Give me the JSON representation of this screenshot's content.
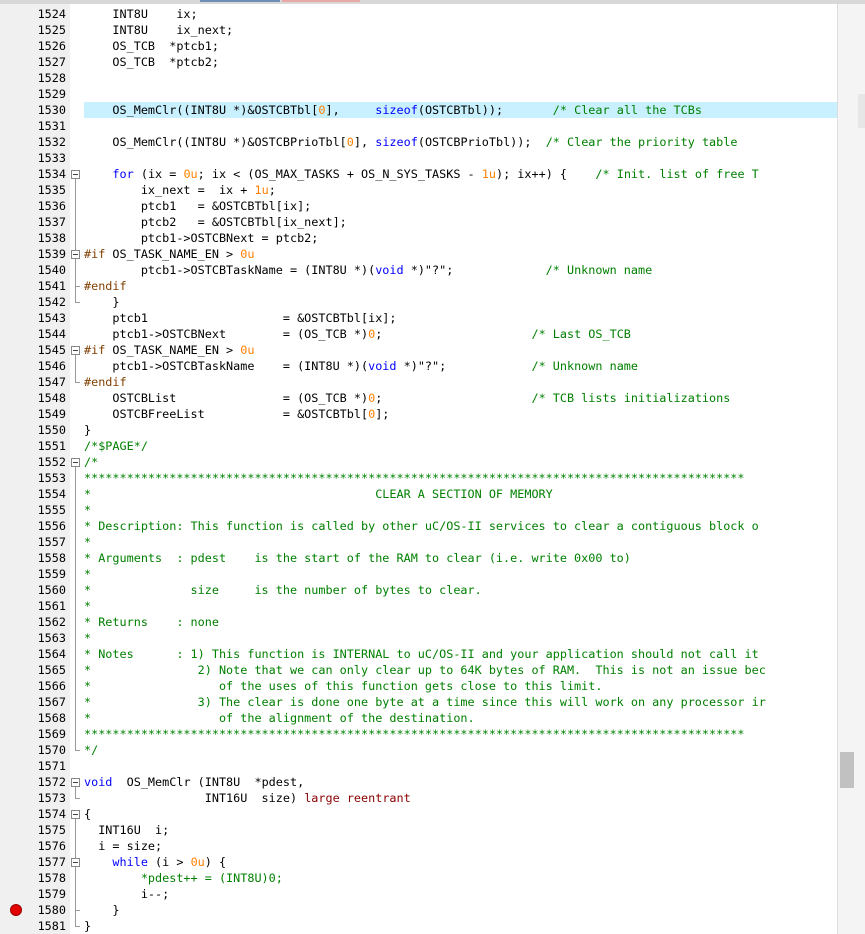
{
  "editor": {
    "lines": [
      {
        "n": "1524",
        "t": "    INT8U    ix;"
      },
      {
        "n": "1525",
        "t": "    INT8U    ix_next;"
      },
      {
        "n": "1526",
        "t": "    OS_TCB  *ptcb1;"
      },
      {
        "n": "1527",
        "t": "    OS_TCB  *ptcb2;"
      },
      {
        "n": "1528",
        "t": ""
      },
      {
        "n": "1529",
        "t": ""
      },
      {
        "n": "1530",
        "t": "    OS_MemClr((INT8U *)&OSTCBTbl[0],     sizeof(OSTCBTbl));       /* Clear all the TCBs"
      },
      {
        "n": "1531",
        "t": ""
      },
      {
        "n": "1532",
        "t": "    OS_MemClr((INT8U *)&OSTCBPrioTbl[0], sizeof(OSTCBPrioTbl));  /* Clear the priority table"
      },
      {
        "n": "1533",
        "t": ""
      },
      {
        "n": "1534",
        "t": "    for (ix = 0u; ix < (OS_MAX_TASKS + OS_N_SYS_TASKS - 1u); ix++) {    /* Init. list of free T"
      },
      {
        "n": "1535",
        "t": "        ix_next =  ix + 1u;"
      },
      {
        "n": "1536",
        "t": "        ptcb1   = &OSTCBTbl[ix];"
      },
      {
        "n": "1537",
        "t": "        ptcb2   = &OSTCBTbl[ix_next];"
      },
      {
        "n": "1538",
        "t": "        ptcb1->OSTCBNext = ptcb2;"
      },
      {
        "n": "1539",
        "t": "#if OS_TASK_NAME_EN > 0u"
      },
      {
        "n": "1540",
        "t": "        ptcb1->OSTCBTaskName = (INT8U *)(void *)\"?\";             /* Unknown name"
      },
      {
        "n": "1541",
        "t": "#endif"
      },
      {
        "n": "1542",
        "t": "    }"
      },
      {
        "n": "1543",
        "t": "    ptcb1                   = &OSTCBTbl[ix];"
      },
      {
        "n": "1544",
        "t": "    ptcb1->OSTCBNext        = (OS_TCB *)0;                     /* Last OS_TCB"
      },
      {
        "n": "1545",
        "t": "#if OS_TASK_NAME_EN > 0u"
      },
      {
        "n": "1546",
        "t": "    ptcb1->OSTCBTaskName    = (INT8U *)(void *)\"?\";            /* Unknown name"
      },
      {
        "n": "1547",
        "t": "#endif"
      },
      {
        "n": "1548",
        "t": "    OSTCBList               = (OS_TCB *)0;                     /* TCB lists initializations"
      },
      {
        "n": "1549",
        "t": "    OSTCBFreeList           = &OSTCBTbl[0];"
      },
      {
        "n": "1550",
        "t": "}"
      },
      {
        "n": "1551",
        "t": "/*$PAGE*/"
      },
      {
        "n": "1552",
        "t": "/*"
      },
      {
        "n": "1553",
        "t": "*********************************************************************************************"
      },
      {
        "n": "1554",
        "t": "*                                        CLEAR A SECTION OF MEMORY"
      },
      {
        "n": "1555",
        "t": "*"
      },
      {
        "n": "1556",
        "t": "* Description: This function is called by other uC/OS-II services to clear a contiguous block o"
      },
      {
        "n": "1557",
        "t": "*"
      },
      {
        "n": "1558",
        "t": "* Arguments  : pdest    is the start of the RAM to clear (i.e. write 0x00 to)"
      },
      {
        "n": "1559",
        "t": "*"
      },
      {
        "n": "1560",
        "t": "*              size     is the number of bytes to clear."
      },
      {
        "n": "1561",
        "t": "*"
      },
      {
        "n": "1562",
        "t": "* Returns    : none"
      },
      {
        "n": "1563",
        "t": "*"
      },
      {
        "n": "1564",
        "t": "* Notes      : 1) This function is INTERNAL to uC/OS-II and your application should not call it"
      },
      {
        "n": "1565",
        "t": "*               2) Note that we can only clear up to 64K bytes of RAM.  This is not an issue bec"
      },
      {
        "n": "1566",
        "t": "*                  of the uses of this function gets close to this limit."
      },
      {
        "n": "1567",
        "t": "*               3) The clear is done one byte at a time since this will work on any processor ir"
      },
      {
        "n": "1568",
        "t": "*                  of the alignment of the destination."
      },
      {
        "n": "1569",
        "t": "*********************************************************************************************"
      },
      {
        "n": "1570",
        "t": "*/"
      },
      {
        "n": "1571",
        "t": ""
      },
      {
        "n": "1572",
        "t": "void  OS_MemClr (INT8U  *pdest,"
      },
      {
        "n": "1573",
        "t": "                 INT16U  size) large reentrant"
      },
      {
        "n": "1574",
        "t": "{"
      },
      {
        "n": "1575",
        "t": "  INT16U  i;"
      },
      {
        "n": "1576",
        "t": "  i = size;"
      },
      {
        "n": "1577",
        "t": "    while (i > 0u) {"
      },
      {
        "n": "1578",
        "t": "        *pdest++ = (INT8U)0;"
      },
      {
        "n": "1579",
        "t": "        i--;"
      },
      {
        "n": "1580",
        "t": "    }"
      },
      {
        "n": "1581",
        "t": "}"
      }
    ]
  },
  "highlight_line": "1530",
  "breakpoint_line": "1580",
  "colors": {
    "keyword": "#0000ff",
    "comment": "#008000",
    "highlight": "#c8f0ff",
    "breakpoint": "#e30000"
  }
}
